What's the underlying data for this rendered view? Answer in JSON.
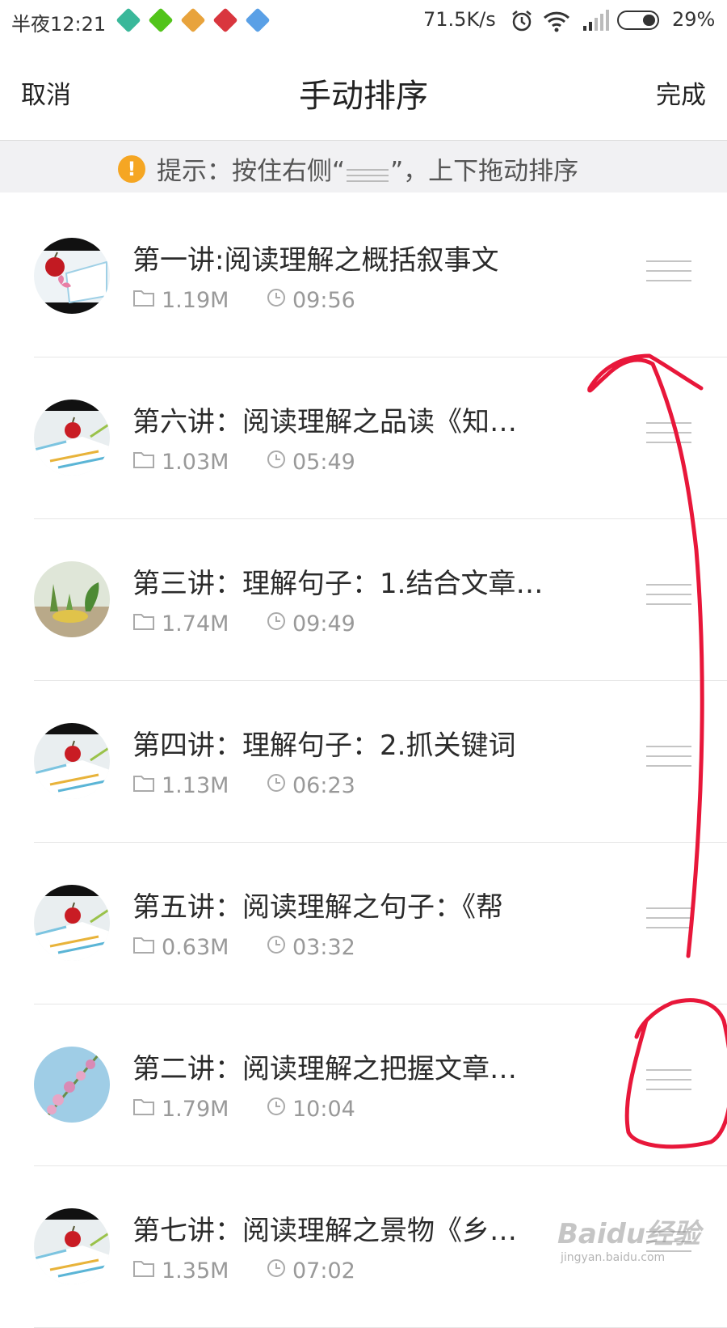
{
  "status_bar": {
    "time": "半夜12:21",
    "notification_icons": [
      {
        "name": "app-notification-icon",
        "color": "#3ab89a"
      },
      {
        "name": "app-notification-icon",
        "color": "#52c41a"
      },
      {
        "name": "app-notification-icon",
        "color": "#e8a33c"
      },
      {
        "name": "app-notification-icon",
        "color": "#d9363e"
      },
      {
        "name": "app-notification-icon",
        "color": "#5aa0e6"
      }
    ],
    "net_speed": "71.5K/s",
    "battery_percent": "29%",
    "battery_level": 0.29
  },
  "nav": {
    "cancel_label": "取消",
    "title": "手动排序",
    "done_label": "完成"
  },
  "hint": {
    "prefix": "提示：按住右侧“",
    "suffix": "”，上下拖动排序",
    "icon": "exclamation-icon"
  },
  "lessons": [
    {
      "title": "第一讲:阅读理解之概括叙事文",
      "size": "1.19M",
      "duration": "09:56",
      "thumb": "apple-butterfly"
    },
    {
      "title": "第六讲：阅读理解之品读《知…",
      "size": "1.03M",
      "duration": "05:49",
      "thumb": "apple-pencils"
    },
    {
      "title": "第三讲：理解句子：1.结合文章…",
      "size": "1.74M",
      "duration": "09:49",
      "thumb": "plants"
    },
    {
      "title": "第四讲：理解句子：2.抓关键词",
      "size": "1.13M",
      "duration": "06:23",
      "thumb": "apple-pencils"
    },
    {
      "title": "第五讲：阅读理解之句子：《帮",
      "size": "0.63M",
      "duration": "03:32",
      "thumb": "apple-pencils"
    },
    {
      "title": "第二讲：阅读理解之把握文章…",
      "size": "1.79M",
      "duration": "10:04",
      "thumb": "flowers"
    },
    {
      "title": "第七讲：阅读理解之景物《乡…",
      "size": "1.35M",
      "duration": "07:02",
      "thumb": "apple-pencils"
    }
  ],
  "colors": {
    "accent": "#f5a623",
    "markup": "#e8173a"
  },
  "watermark": {
    "brand": "Baidu经验",
    "url": "jingyan.baidu.com"
  }
}
